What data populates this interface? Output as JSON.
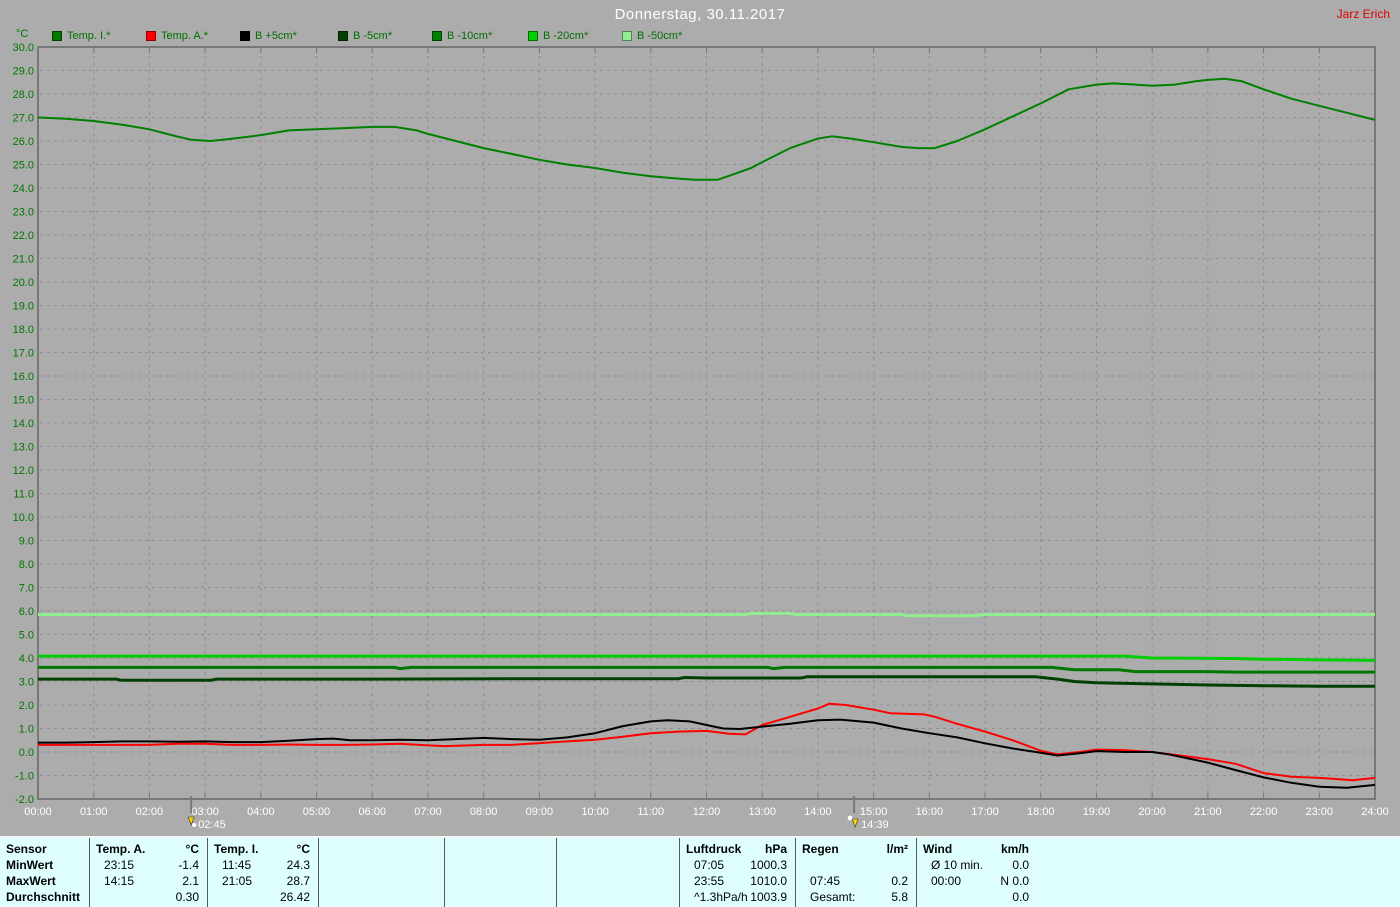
{
  "header": {
    "title": "Donnerstag, 30.11.2017",
    "watermark": "Jarz Erich"
  },
  "legend": {
    "unit": "°C",
    "items": [
      {
        "label": "Temp. I.*",
        "color": "#007800"
      },
      {
        "label": "Temp. A.*",
        "color": "#FF0000"
      },
      {
        "label": "B +5cm*",
        "color": "#000000"
      },
      {
        "label": "B -5cm*",
        "color": "#004000"
      },
      {
        "label": "B -10cm*",
        "color": "#008000"
      },
      {
        "label": "B -20cm*",
        "color": "#00CE00"
      },
      {
        "label": "B -50cm*",
        "color": "#90EE90"
      }
    ]
  },
  "chart_data": {
    "type": "line",
    "title": "Donnerstag, 30.11.2017",
    "ylabel": "°C",
    "ylim": [
      -2,
      30
    ],
    "y_tick_step": 1,
    "x_hours": [
      0,
      24
    ],
    "x_ticks": [
      "00:00",
      "01:00",
      "02:00",
      "03:00",
      "04:00",
      "05:00",
      "06:00",
      "07:00",
      "08:00",
      "09:00",
      "10:00",
      "11:00",
      "12:00",
      "13:00",
      "14:00",
      "15:00",
      "16:00",
      "17:00",
      "18:00",
      "19:00",
      "20:00",
      "21:00",
      "22:00",
      "23:00",
      "24:00"
    ],
    "grid": true,
    "legend_position": "top",
    "event_markers": [
      {
        "label": "02:45",
        "hour": 2.75,
        "icon": "rise-icon"
      },
      {
        "label": "14:39",
        "hour": 14.65,
        "icon": "set-icon"
      }
    ],
    "series": [
      {
        "name": "Temp. I.*",
        "color": "#008000",
        "width": 2,
        "points": [
          [
            0,
            27.0
          ],
          [
            0.5,
            26.95
          ],
          [
            1,
            26.85
          ],
          [
            1.5,
            26.7
          ],
          [
            2,
            26.5
          ],
          [
            2.4,
            26.25
          ],
          [
            2.75,
            26.05
          ],
          [
            3.1,
            26.0
          ],
          [
            3.5,
            26.1
          ],
          [
            4,
            26.25
          ],
          [
            4.5,
            26.45
          ],
          [
            5,
            26.5
          ],
          [
            5.5,
            26.55
          ],
          [
            6,
            26.6
          ],
          [
            6.4,
            26.6
          ],
          [
            6.8,
            26.45
          ],
          [
            7,
            26.3
          ],
          [
            7.5,
            26.0
          ],
          [
            8,
            25.7
          ],
          [
            8.5,
            25.45
          ],
          [
            9,
            25.2
          ],
          [
            9.5,
            25.0
          ],
          [
            10,
            24.85
          ],
          [
            10.5,
            24.65
          ],
          [
            11,
            24.5
          ],
          [
            11.5,
            24.4
          ],
          [
            11.8,
            24.35
          ],
          [
            12.2,
            24.35
          ],
          [
            12.5,
            24.6
          ],
          [
            12.8,
            24.85
          ],
          [
            13,
            25.1
          ],
          [
            13.5,
            25.7
          ],
          [
            14,
            26.1
          ],
          [
            14.25,
            26.2
          ],
          [
            14.6,
            26.1
          ],
          [
            15,
            25.95
          ],
          [
            15.5,
            25.75
          ],
          [
            15.8,
            25.7
          ],
          [
            16.1,
            25.7
          ],
          [
            16.5,
            26.0
          ],
          [
            17,
            26.5
          ],
          [
            17.5,
            27.05
          ],
          [
            18,
            27.6
          ],
          [
            18.5,
            28.2
          ],
          [
            19,
            28.4
          ],
          [
            19.3,
            28.45
          ],
          [
            19.7,
            28.4
          ],
          [
            20,
            28.35
          ],
          [
            20.4,
            28.4
          ],
          [
            20.8,
            28.55
          ],
          [
            21,
            28.6
          ],
          [
            21.3,
            28.65
          ],
          [
            21.6,
            28.55
          ],
          [
            22,
            28.2
          ],
          [
            22.5,
            27.8
          ],
          [
            23,
            27.5
          ],
          [
            23.5,
            27.2
          ],
          [
            24,
            26.9
          ]
        ]
      },
      {
        "name": "Temp. A.*",
        "color": "#FF0000",
        "width": 2,
        "points": [
          [
            0,
            0.3
          ],
          [
            1,
            0.3
          ],
          [
            2,
            0.3
          ],
          [
            2.5,
            0.35
          ],
          [
            3,
            0.35
          ],
          [
            3.5,
            0.3
          ],
          [
            4,
            0.3
          ],
          [
            4.5,
            0.32
          ],
          [
            5,
            0.3
          ],
          [
            5.5,
            0.3
          ],
          [
            6,
            0.32
          ],
          [
            6.5,
            0.35
          ],
          [
            7,
            0.28
          ],
          [
            7.3,
            0.25
          ],
          [
            8,
            0.3
          ],
          [
            8.5,
            0.3
          ],
          [
            9,
            0.38
          ],
          [
            9.5,
            0.45
          ],
          [
            10,
            0.52
          ],
          [
            10.5,
            0.65
          ],
          [
            11,
            0.8
          ],
          [
            11.5,
            0.87
          ],
          [
            12,
            0.9
          ],
          [
            12.4,
            0.78
          ],
          [
            12.7,
            0.75
          ],
          [
            13,
            1.15
          ],
          [
            13.5,
            1.5
          ],
          [
            14,
            1.85
          ],
          [
            14.2,
            2.05
          ],
          [
            14.5,
            2.0
          ],
          [
            15,
            1.8
          ],
          [
            15.3,
            1.65
          ],
          [
            15.9,
            1.6
          ],
          [
            16.1,
            1.5
          ],
          [
            16.5,
            1.2
          ],
          [
            17,
            0.87
          ],
          [
            17.5,
            0.5
          ],
          [
            18,
            0.05
          ],
          [
            18.3,
            -0.1
          ],
          [
            18.7,
            0.0
          ],
          [
            19,
            0.1
          ],
          [
            19.5,
            0.08
          ],
          [
            20,
            0.0
          ],
          [
            20.5,
            -0.15
          ],
          [
            21,
            -0.3
          ],
          [
            21.5,
            -0.5
          ],
          [
            22,
            -0.9
          ],
          [
            22.5,
            -1.05
          ],
          [
            23,
            -1.1
          ],
          [
            23.3,
            -1.15
          ],
          [
            23.6,
            -1.2
          ],
          [
            24,
            -1.1
          ]
        ]
      },
      {
        "name": "B +5cm*",
        "color": "#000000",
        "width": 2,
        "points": [
          [
            0,
            0.4
          ],
          [
            0.5,
            0.4
          ],
          [
            1,
            0.42
          ],
          [
            1.5,
            0.45
          ],
          [
            2,
            0.45
          ],
          [
            2.5,
            0.44
          ],
          [
            3,
            0.45
          ],
          [
            3.5,
            0.42
          ],
          [
            4,
            0.42
          ],
          [
            4.5,
            0.48
          ],
          [
            5,
            0.55
          ],
          [
            5.3,
            0.57
          ],
          [
            5.6,
            0.5
          ],
          [
            6,
            0.5
          ],
          [
            6.5,
            0.52
          ],
          [
            7,
            0.5
          ],
          [
            7.5,
            0.55
          ],
          [
            8,
            0.6
          ],
          [
            8.5,
            0.55
          ],
          [
            9,
            0.52
          ],
          [
            9.5,
            0.62
          ],
          [
            10,
            0.8
          ],
          [
            10.5,
            1.1
          ],
          [
            11,
            1.3
          ],
          [
            11.3,
            1.35
          ],
          [
            11.7,
            1.3
          ],
          [
            12,
            1.15
          ],
          [
            12.3,
            1.0
          ],
          [
            12.6,
            0.98
          ],
          [
            13,
            1.08
          ],
          [
            13.5,
            1.2
          ],
          [
            14,
            1.35
          ],
          [
            14.4,
            1.38
          ],
          [
            15,
            1.25
          ],
          [
            15.5,
            1.0
          ],
          [
            16,
            0.8
          ],
          [
            16.5,
            0.62
          ],
          [
            17,
            0.37
          ],
          [
            17.5,
            0.15
          ],
          [
            18,
            -0.03
          ],
          [
            18.3,
            -0.15
          ],
          [
            18.7,
            -0.05
          ],
          [
            19,
            0.04
          ],
          [
            19.5,
            0.0
          ],
          [
            20,
            0.0
          ],
          [
            20.3,
            -0.1
          ],
          [
            21,
            -0.45
          ],
          [
            21.5,
            -0.77
          ],
          [
            22,
            -1.08
          ],
          [
            22.5,
            -1.31
          ],
          [
            23,
            -1.48
          ],
          [
            23.5,
            -1.52
          ],
          [
            24,
            -1.4
          ]
        ]
      },
      {
        "name": "B -5cm*",
        "color": "#004000",
        "width": 3,
        "points": [
          [
            0,
            3.1
          ],
          [
            1.4,
            3.1
          ],
          [
            1.5,
            3.05
          ],
          [
            3.1,
            3.05
          ],
          [
            3.2,
            3.1
          ],
          [
            6,
            3.1
          ],
          [
            9,
            3.12
          ],
          [
            11.5,
            3.12
          ],
          [
            11.6,
            3.17
          ],
          [
            12,
            3.15
          ],
          [
            13.7,
            3.15
          ],
          [
            13.8,
            3.2
          ],
          [
            17,
            3.2
          ],
          [
            17.9,
            3.2
          ],
          [
            18.3,
            3.1
          ],
          [
            18.6,
            3.0
          ],
          [
            19,
            2.95
          ],
          [
            20,
            2.9
          ],
          [
            21,
            2.85
          ],
          [
            22,
            2.82
          ],
          [
            23,
            2.8
          ],
          [
            24,
            2.8
          ]
        ]
      },
      {
        "name": "B -10cm*",
        "color": "#007800",
        "width": 3,
        "points": [
          [
            0,
            3.6
          ],
          [
            6.4,
            3.6
          ],
          [
            6.5,
            3.55
          ],
          [
            6.7,
            3.6
          ],
          [
            13.1,
            3.6
          ],
          [
            13.2,
            3.55
          ],
          [
            13.4,
            3.6
          ],
          [
            18.2,
            3.6
          ],
          [
            18.6,
            3.5
          ],
          [
            19.4,
            3.5
          ],
          [
            19.7,
            3.42
          ],
          [
            21,
            3.42
          ],
          [
            21.5,
            3.4
          ],
          [
            24,
            3.4
          ]
        ]
      },
      {
        "name": "B -20cm*",
        "color": "#00CE00",
        "width": 3,
        "points": [
          [
            0,
            4.08
          ],
          [
            19.5,
            4.08
          ],
          [
            20,
            4.0
          ],
          [
            21.5,
            3.98
          ],
          [
            22,
            3.95
          ],
          [
            23,
            3.92
          ],
          [
            24,
            3.9
          ]
        ]
      },
      {
        "name": "B -50cm*",
        "color": "#90EE90",
        "width": 3,
        "points": [
          [
            0,
            5.85
          ],
          [
            12.7,
            5.85
          ],
          [
            12.8,
            5.9
          ],
          [
            13.5,
            5.9
          ],
          [
            13.6,
            5.85
          ],
          [
            15.5,
            5.85
          ],
          [
            15.6,
            5.8
          ],
          [
            16.8,
            5.8
          ],
          [
            17,
            5.85
          ],
          [
            24,
            5.85
          ]
        ]
      }
    ]
  },
  "stats_table": {
    "row_labels": [
      "Sensor",
      "MinWert",
      "MaxWert",
      "Durchschnitt"
    ],
    "columns": [
      {
        "header": "Temp. A.",
        "unit": "°C",
        "rows": [
          [
            "23:15",
            "-1.4"
          ],
          [
            "14:15",
            "2.1"
          ],
          [
            "",
            "0.30"
          ]
        ]
      },
      {
        "header": "Temp. I.",
        "unit": "°C",
        "rows": [
          [
            "11:45",
            "24.3"
          ],
          [
            "21:05",
            "28.7"
          ],
          [
            "",
            "26.42"
          ]
        ]
      },
      {
        "header": "",
        "unit": "",
        "rows": [
          [
            "",
            ""
          ],
          [
            "",
            ""
          ],
          [
            "",
            ""
          ]
        ]
      },
      {
        "header": "",
        "unit": "",
        "rows": [
          [
            "",
            ""
          ],
          [
            "",
            ""
          ],
          [
            "",
            ""
          ]
        ]
      },
      {
        "header": "",
        "unit": "",
        "rows": [
          [
            "",
            ""
          ],
          [
            "",
            ""
          ],
          [
            "",
            ""
          ]
        ]
      },
      {
        "header": "Luftdruck",
        "unit": "hPa",
        "rows": [
          [
            "07:05",
            "1000.3"
          ],
          [
            "23:55",
            "1010.0"
          ],
          [
            "^1.3hPa/h",
            "1003.9"
          ]
        ]
      },
      {
        "header": "Regen",
        "unit": "l/m²",
        "rows": [
          [
            "",
            ""
          ],
          [
            "07:45",
            "0.2"
          ],
          [
            "Gesamt:",
            "5.8"
          ]
        ]
      },
      {
        "header": "Wind",
        "unit": "km/h",
        "rows": [
          [
            "Ø 10 min.",
            "0.0"
          ],
          [
            "00:00",
            "N 0.0"
          ],
          [
            "",
            "0.0"
          ]
        ]
      }
    ]
  }
}
